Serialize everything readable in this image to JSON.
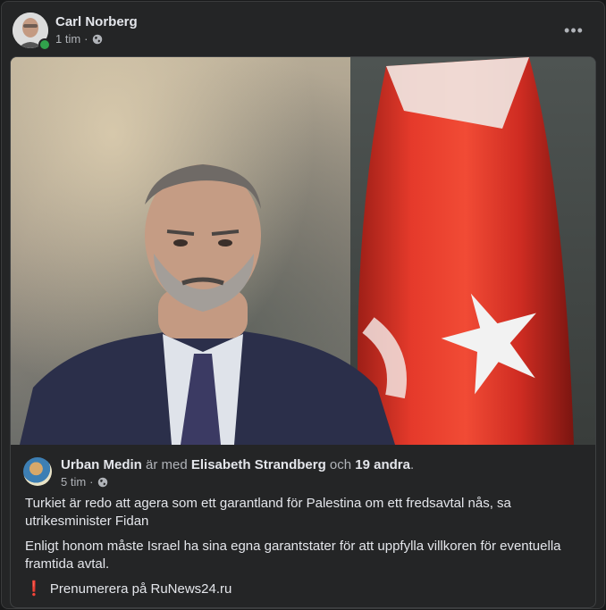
{
  "post": {
    "author": "Carl Norberg",
    "time": "1 tim",
    "separator": "·",
    "more_label": "•••"
  },
  "shared_post": {
    "author": "Urban Medin",
    "with_text": "är med",
    "tagged": "Elisabeth Strandberg",
    "and_text": "och",
    "others": "19 andra",
    "period": ".",
    "time": "5 tim",
    "separator": "·",
    "paragraphs": [
      "Turkiet är redo att agera som ett garantland för Palestina om ett fredsavtal nås, sa utrikesminister Fidan",
      "Enligt honom måste Israel ha sina egna garantstater för att uppfylla villkoren för eventuella framtida avtal."
    ],
    "subscribe_icon": "❗",
    "subscribe_text": "Prenumerera på RuNews24.ru"
  },
  "colors": {
    "card_bg": "#242526",
    "text_primary": "#e4e6eb",
    "text_secondary": "#b0b3b8",
    "online": "#31a24c",
    "flag_red": "#e8392c"
  },
  "icons": [
    "globe-icon",
    "more-icon",
    "exclamation-icon"
  ]
}
